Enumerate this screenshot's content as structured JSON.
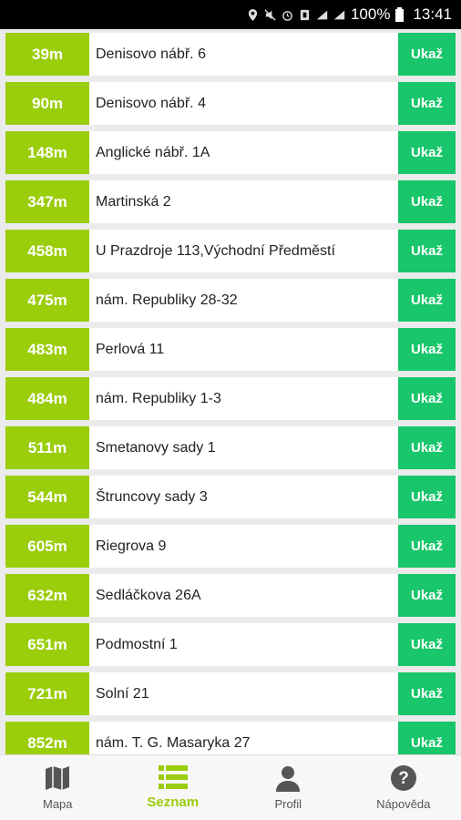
{
  "status_bar": {
    "battery": "100%",
    "time": "13:41"
  },
  "list": [
    {
      "distance": "39m",
      "address": "Denisovo nábř. 6",
      "button": "Ukaž"
    },
    {
      "distance": "90m",
      "address": "Denisovo nábř. 4",
      "button": "Ukaž"
    },
    {
      "distance": "148m",
      "address": "Anglické nábř. 1A",
      "button": "Ukaž"
    },
    {
      "distance": "347m",
      "address": "Martinská 2",
      "button": "Ukaž"
    },
    {
      "distance": "458m",
      "address": "U Prazdroje 113,Východní Předměstí",
      "button": "Ukaž"
    },
    {
      "distance": "475m",
      "address": "nám. Republiky 28-32",
      "button": "Ukaž"
    },
    {
      "distance": "483m",
      "address": "Perlová 11",
      "button": "Ukaž"
    },
    {
      "distance": "484m",
      "address": "nám. Republiky 1-3",
      "button": "Ukaž"
    },
    {
      "distance": "511m",
      "address": "Smetanovy sady 1",
      "button": "Ukaž"
    },
    {
      "distance": "544m",
      "address": "Štruncovy sady 3",
      "button": "Ukaž"
    },
    {
      "distance": "605m",
      "address": "Riegrova 9",
      "button": "Ukaž"
    },
    {
      "distance": "632m",
      "address": "Sedláčkova 26A",
      "button": "Ukaž"
    },
    {
      "distance": "651m",
      "address": "Podmostní 1",
      "button": "Ukaž"
    },
    {
      "distance": "721m",
      "address": "Solní 21",
      "button": "Ukaž"
    },
    {
      "distance": "852m",
      "address": "nám. T. G. Masaryka 27",
      "button": "Ukaž"
    }
  ],
  "bottom_nav": {
    "items": [
      {
        "label": "Mapa",
        "icon": "map-icon"
      },
      {
        "label": "Seznam",
        "icon": "list-icon"
      },
      {
        "label": "Profil",
        "icon": "person-icon"
      },
      {
        "label": "Nápověda",
        "icon": "help-icon"
      }
    ],
    "active": "Seznam"
  },
  "colors": {
    "distance_bg": "#9acd0a",
    "button_bg": "#19c66b",
    "active_nav": "#9acd0a"
  }
}
